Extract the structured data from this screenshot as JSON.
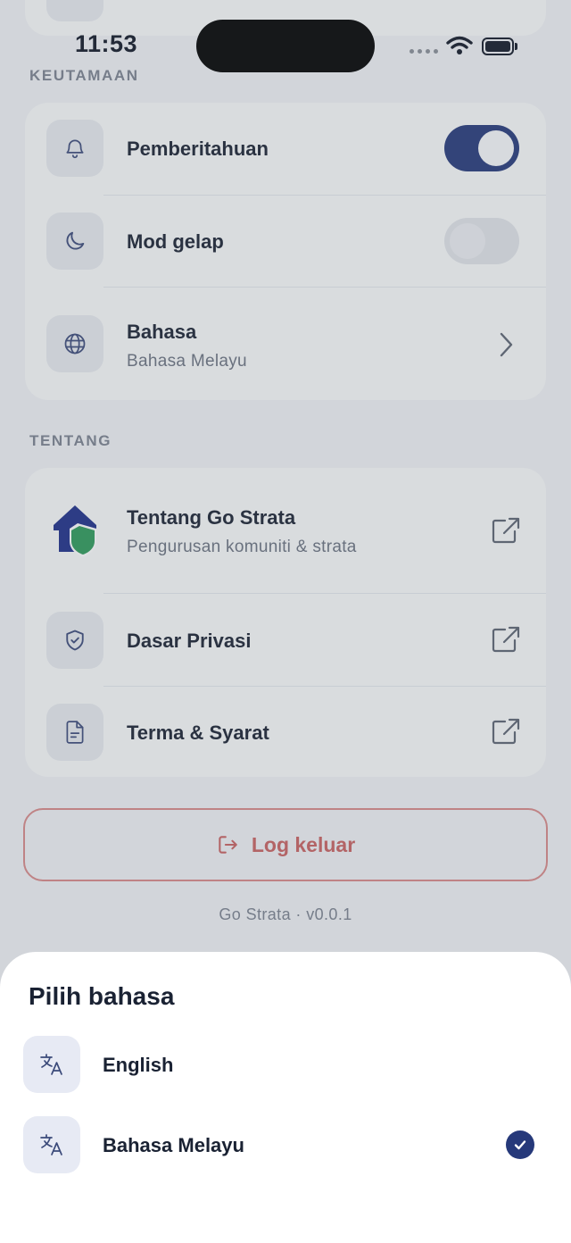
{
  "status_bar": {
    "time": "11:53"
  },
  "preferences": {
    "section_label": "KEUTAMAAN",
    "notifications": {
      "label": "Pemberitahuan",
      "enabled": true
    },
    "dark_mode": {
      "label": "Mod gelap",
      "enabled": false
    },
    "language": {
      "label": "Bahasa",
      "value": "Bahasa Melayu"
    }
  },
  "about": {
    "section_label": "TENTANG",
    "about_app": {
      "title": "Tentang Go Strata",
      "subtitle": "Pengurusan komuniti & strata"
    },
    "privacy": {
      "label": "Dasar Privasi"
    },
    "terms": {
      "label": "Terma & Syarat"
    }
  },
  "logout_label": "Log keluar",
  "version_text": "Go Strata · v0.0.1",
  "language_sheet": {
    "title": "Pilih bahasa",
    "options": [
      {
        "label": "English",
        "selected": false
      },
      {
        "label": "Bahasa Melayu",
        "selected": true
      }
    ]
  },
  "colors": {
    "accent": "#26397a",
    "danger": "#c96262",
    "logo_house": "#1e2f8a",
    "logo_shield": "#2e9a5a"
  },
  "icons": {
    "notifications": "bell-icon",
    "dark_mode": "moon-icon",
    "language": "globe-icon",
    "about": "go-strata-logo",
    "privacy": "shield-check-icon",
    "terms": "document-icon",
    "external": "external-link-icon",
    "chevron": "chevron-right-icon",
    "logout": "logout-icon",
    "translate": "translate-icon",
    "check": "check-icon"
  }
}
